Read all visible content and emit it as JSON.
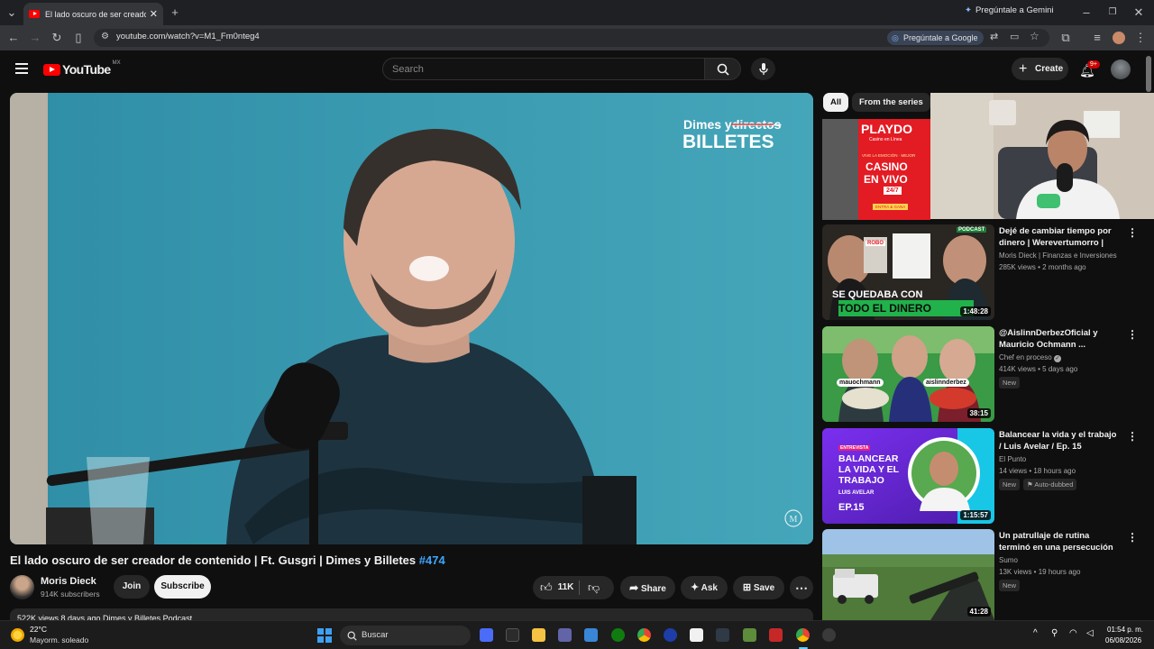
{
  "browser": {
    "tab_title": "El lado oscuro de ser creador d",
    "gemini_button": "Pregúntale a Gemini",
    "url": "youtube.com/watch?v=M1_Fm0nteg4",
    "ask_google": "Pregúntale a Google"
  },
  "header": {
    "logo_text": "YouTube",
    "region": "MX",
    "search_placeholder": "Search",
    "create_label": "Create",
    "notifications_badge": "9+"
  },
  "player": {
    "overlay_line1_a": "Dimes y",
    "overlay_line1_b": "directos",
    "overlay_line2": "BILLETES",
    "watermark": "M"
  },
  "video": {
    "title": "El lado oscuro de ser creador de contenido | Ft. Gusgri | Dimes y Billetes",
    "title_tag": "#474",
    "channel": "Moris Dieck",
    "subscribers": "914K subscribers",
    "join_label": "Join",
    "subscribe_label": "Subscribe",
    "likes": "11K",
    "share_label": "Share",
    "ask_label": "Ask",
    "save_label": "Save",
    "description_peek": "522K views  8 days ago  Dimes y Billetes Podcast"
  },
  "sidebar": {
    "chips": [
      "All",
      "From the series"
    ],
    "ad": {
      "brand": "PLAYDO",
      "sub": "Casino en Línea",
      "line1": "VIVE LA EMOCIÓN · MEJOR",
      "line2": "CASINO",
      "line3": "EN VIVO",
      "line4": "24/7",
      "cta": "ENTRA & GANA"
    },
    "items": [
      {
        "title": "Dejé de cambiar tiempo por dinero | Werevertumorro | Dim...",
        "channel": "Moris Dieck | Finanzas e Inversiones",
        "meta": "285K views • 2 months ago",
        "duration": "1:48:28",
        "thumb_text1": "SE QUEDABA CON",
        "thumb_text2": "TODO EL DINERO",
        "thumb_tag": "ROBO",
        "thumb_podcast": "PODCAST",
        "badges": []
      },
      {
        "title": "@AislinnDerbezOficial y Mauricio Ochmann ...",
        "channel": "Chef en proceso",
        "meta": "414K views • 5 days ago",
        "duration": "38:15",
        "thumb_text1": "mauochmann",
        "thumb_text2": "aislinnderbez",
        "badges": [
          "New"
        ]
      },
      {
        "title": "Balancear la vida y el trabajo / Luis Avelar / Ep. 15",
        "channel": "El Punto",
        "meta": "14 views • 18 hours ago",
        "duration": "1:15:57",
        "thumb_tag": "ENTREVISTA",
        "thumb_text1": "BALANCEAR LA VIDA Y EL TRABAJO",
        "thumb_text2": "LUIS AVELAR",
        "thumb_ep": "EP.15",
        "badges": [
          "New",
          "Auto-dubbed"
        ]
      },
      {
        "title": "Un patrullaje de rutina terminó en una persecución como la ...",
        "channel": "Sumo",
        "meta": "13K views • 19 hours ago",
        "duration": "41:28",
        "badges": [
          "New"
        ]
      }
    ]
  },
  "taskbar": {
    "temperature": "22°C",
    "weather": "Mayorm. soleado",
    "search_label": "Buscar",
    "time": "01:54 p. m.",
    "date": "06/08/2026"
  },
  "colors": {
    "yt_red": "#ff0000",
    "link_blue": "#3ea6ff",
    "background": "#0f0f0f"
  }
}
